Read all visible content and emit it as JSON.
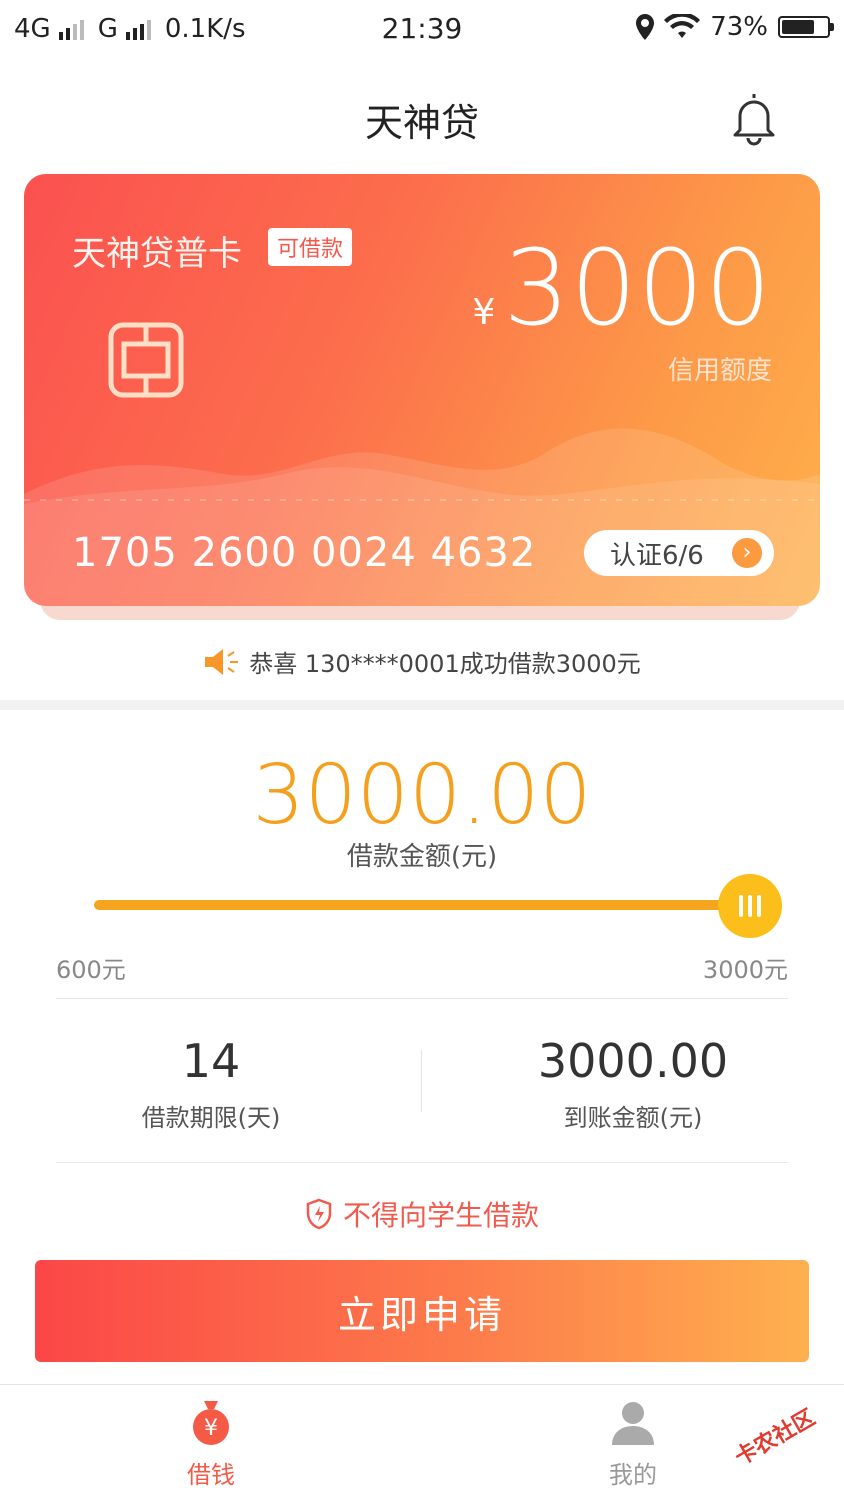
{
  "status_bar": {
    "network1": "4G",
    "network2": "G",
    "speed": "0.1K/s",
    "time": "21:39",
    "battery_percent": "73%",
    "battery_level": 0.73
  },
  "header": {
    "title": "天神贷",
    "bell_icon": "bell-icon"
  },
  "card": {
    "title": "天神贷普卡",
    "badge": "可借款",
    "currency": "¥",
    "limit": "3000",
    "limit_label": "信用额度",
    "card_number": "1705 2600 0024 4632",
    "auth_label": "认证6/6",
    "auth_arrow": "›"
  },
  "notice": {
    "text": "恭喜 130****0001成功借款3000元",
    "icon": "speaker-icon"
  },
  "loan": {
    "amount": "3000.00",
    "amount_label": "借款金额(元)",
    "slider_min": "600元",
    "slider_max": "3000元",
    "slider_fraction": 1.0,
    "term_value": "14",
    "term_label": "借款期限(天)",
    "received_value": "3000.00",
    "received_label": "到账金额(元)",
    "warning": "不得向学生借款",
    "apply_label": "立即申请"
  },
  "tabbar": {
    "tabs": [
      {
        "label": "借钱",
        "icon": "money-bag-icon",
        "active": true
      },
      {
        "label": "我的",
        "icon": "user-icon",
        "active": false
      }
    ]
  },
  "watermark": "卡农社区",
  "colors": {
    "accent_orange": "#f5a01d",
    "accent_red": "#f45a46"
  }
}
